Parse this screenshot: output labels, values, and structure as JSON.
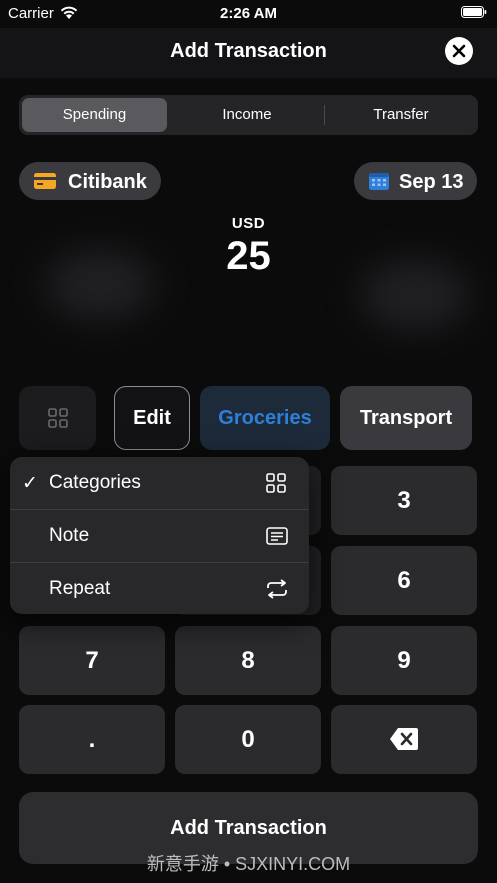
{
  "status_bar": {
    "carrier": "Carrier",
    "time": "2:26 AM"
  },
  "header": {
    "title": "Add Transaction"
  },
  "segments": [
    {
      "label": "Spending",
      "selected": true
    },
    {
      "label": "Income",
      "selected": false
    },
    {
      "label": "Transfer",
      "selected": false
    }
  ],
  "account": {
    "label": "Citibank",
    "icon": "card-icon",
    "icon_color": "#f5a623"
  },
  "date": {
    "label": "Sep 13",
    "icon": "calendar-icon",
    "icon_color": "#2f7fd8"
  },
  "amount": {
    "currency": "USD",
    "value": "25"
  },
  "categories": {
    "edit_label": "Edit",
    "items": [
      {
        "label": "Groceries",
        "selected": true,
        "color": "#2f7fd8"
      },
      {
        "label": "Transport",
        "selected": false
      }
    ]
  },
  "menu": {
    "items": [
      {
        "label": "Categories",
        "checked": true,
        "icon": "grid-icon"
      },
      {
        "label": "Note",
        "checked": false,
        "icon": "note-icon"
      },
      {
        "label": "Repeat",
        "checked": false,
        "icon": "repeat-icon"
      }
    ],
    "check_mark": "✓"
  },
  "keypad": {
    "k3": "3",
    "k6": "6",
    "k7": "7",
    "k8": "8",
    "k9": "9",
    "kdot": ".",
    "k0": "0",
    "backspace_icon": "backspace-icon"
  },
  "footer": {
    "button_label": "Add Transaction",
    "watermark": "新意手游 • SJXINYI.COM"
  }
}
